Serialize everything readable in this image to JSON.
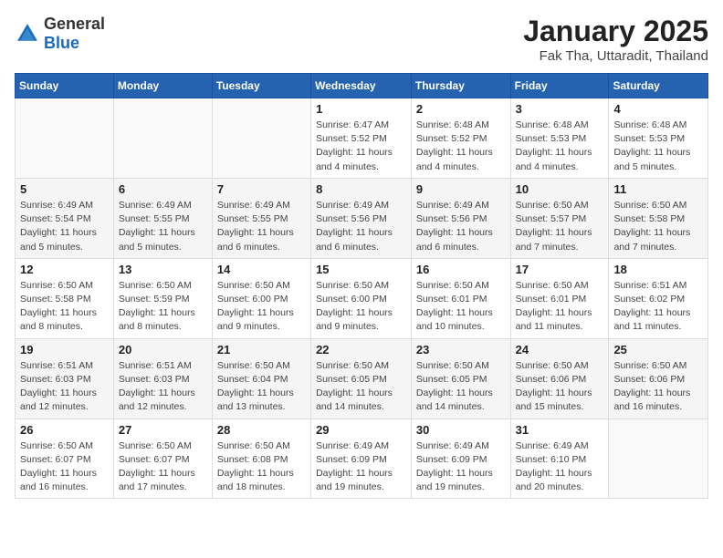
{
  "header": {
    "logo": {
      "general": "General",
      "blue": "Blue"
    },
    "title": "January 2025",
    "location": "Fak Tha, Uttaradit, Thailand"
  },
  "weekdays": [
    "Sunday",
    "Monday",
    "Tuesday",
    "Wednesday",
    "Thursday",
    "Friday",
    "Saturday"
  ],
  "weeks": [
    [
      {
        "day": "",
        "info": ""
      },
      {
        "day": "",
        "info": ""
      },
      {
        "day": "",
        "info": ""
      },
      {
        "day": "1",
        "info": "Sunrise: 6:47 AM\nSunset: 5:52 PM\nDaylight: 11 hours and 4 minutes."
      },
      {
        "day": "2",
        "info": "Sunrise: 6:48 AM\nSunset: 5:52 PM\nDaylight: 11 hours and 4 minutes."
      },
      {
        "day": "3",
        "info": "Sunrise: 6:48 AM\nSunset: 5:53 PM\nDaylight: 11 hours and 4 minutes."
      },
      {
        "day": "4",
        "info": "Sunrise: 6:48 AM\nSunset: 5:53 PM\nDaylight: 11 hours and 5 minutes."
      }
    ],
    [
      {
        "day": "5",
        "info": "Sunrise: 6:49 AM\nSunset: 5:54 PM\nDaylight: 11 hours and 5 minutes."
      },
      {
        "day": "6",
        "info": "Sunrise: 6:49 AM\nSunset: 5:55 PM\nDaylight: 11 hours and 5 minutes."
      },
      {
        "day": "7",
        "info": "Sunrise: 6:49 AM\nSunset: 5:55 PM\nDaylight: 11 hours and 6 minutes."
      },
      {
        "day": "8",
        "info": "Sunrise: 6:49 AM\nSunset: 5:56 PM\nDaylight: 11 hours and 6 minutes."
      },
      {
        "day": "9",
        "info": "Sunrise: 6:49 AM\nSunset: 5:56 PM\nDaylight: 11 hours and 6 minutes."
      },
      {
        "day": "10",
        "info": "Sunrise: 6:50 AM\nSunset: 5:57 PM\nDaylight: 11 hours and 7 minutes."
      },
      {
        "day": "11",
        "info": "Sunrise: 6:50 AM\nSunset: 5:58 PM\nDaylight: 11 hours and 7 minutes."
      }
    ],
    [
      {
        "day": "12",
        "info": "Sunrise: 6:50 AM\nSunset: 5:58 PM\nDaylight: 11 hours and 8 minutes."
      },
      {
        "day": "13",
        "info": "Sunrise: 6:50 AM\nSunset: 5:59 PM\nDaylight: 11 hours and 8 minutes."
      },
      {
        "day": "14",
        "info": "Sunrise: 6:50 AM\nSunset: 6:00 PM\nDaylight: 11 hours and 9 minutes."
      },
      {
        "day": "15",
        "info": "Sunrise: 6:50 AM\nSunset: 6:00 PM\nDaylight: 11 hours and 9 minutes."
      },
      {
        "day": "16",
        "info": "Sunrise: 6:50 AM\nSunset: 6:01 PM\nDaylight: 11 hours and 10 minutes."
      },
      {
        "day": "17",
        "info": "Sunrise: 6:50 AM\nSunset: 6:01 PM\nDaylight: 11 hours and 11 minutes."
      },
      {
        "day": "18",
        "info": "Sunrise: 6:51 AM\nSunset: 6:02 PM\nDaylight: 11 hours and 11 minutes."
      }
    ],
    [
      {
        "day": "19",
        "info": "Sunrise: 6:51 AM\nSunset: 6:03 PM\nDaylight: 11 hours and 12 minutes."
      },
      {
        "day": "20",
        "info": "Sunrise: 6:51 AM\nSunset: 6:03 PM\nDaylight: 11 hours and 12 minutes."
      },
      {
        "day": "21",
        "info": "Sunrise: 6:50 AM\nSunset: 6:04 PM\nDaylight: 11 hours and 13 minutes."
      },
      {
        "day": "22",
        "info": "Sunrise: 6:50 AM\nSunset: 6:05 PM\nDaylight: 11 hours and 14 minutes."
      },
      {
        "day": "23",
        "info": "Sunrise: 6:50 AM\nSunset: 6:05 PM\nDaylight: 11 hours and 14 minutes."
      },
      {
        "day": "24",
        "info": "Sunrise: 6:50 AM\nSunset: 6:06 PM\nDaylight: 11 hours and 15 minutes."
      },
      {
        "day": "25",
        "info": "Sunrise: 6:50 AM\nSunset: 6:06 PM\nDaylight: 11 hours and 16 minutes."
      }
    ],
    [
      {
        "day": "26",
        "info": "Sunrise: 6:50 AM\nSunset: 6:07 PM\nDaylight: 11 hours and 16 minutes."
      },
      {
        "day": "27",
        "info": "Sunrise: 6:50 AM\nSunset: 6:07 PM\nDaylight: 11 hours and 17 minutes."
      },
      {
        "day": "28",
        "info": "Sunrise: 6:50 AM\nSunset: 6:08 PM\nDaylight: 11 hours and 18 minutes."
      },
      {
        "day": "29",
        "info": "Sunrise: 6:49 AM\nSunset: 6:09 PM\nDaylight: 11 hours and 19 minutes."
      },
      {
        "day": "30",
        "info": "Sunrise: 6:49 AM\nSunset: 6:09 PM\nDaylight: 11 hours and 19 minutes."
      },
      {
        "day": "31",
        "info": "Sunrise: 6:49 AM\nSunset: 6:10 PM\nDaylight: 11 hours and 20 minutes."
      },
      {
        "day": "",
        "info": ""
      }
    ]
  ]
}
